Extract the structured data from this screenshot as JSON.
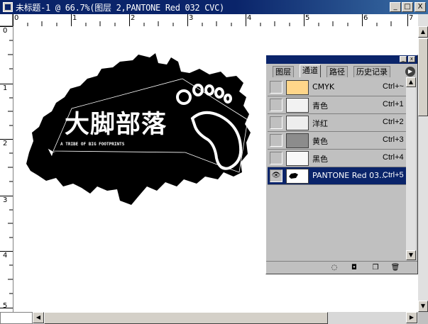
{
  "window": {
    "title": "未标题-1 @ 66.7%(图层 2,PANTONE Red 032 CVC)",
    "min_label": "_",
    "max_label": "□",
    "close_label": "X"
  },
  "ruler": {
    "top_ticks": [
      "0",
      "1",
      "2",
      "3",
      "4",
      "5",
      "6",
      "7"
    ],
    "left_ticks": [
      "0",
      "1",
      "2",
      "3",
      "4",
      "5"
    ]
  },
  "artwork": {
    "headline": "大脚部落",
    "tagline": "A TRIBE OF BIG FOOTPRINTS"
  },
  "palette": {
    "tabs": [
      "图层",
      "通道",
      "路径",
      "历史记录"
    ],
    "active_tab": "通道",
    "channels": [
      {
        "name": "CMYK",
        "shortcut": "Ctrl+~",
        "swatch": "#ffd68a",
        "visible": false,
        "selected": false
      },
      {
        "name": "青色",
        "shortcut": "Ctrl+1",
        "swatch": "#f2f2f2",
        "visible": false,
        "selected": false
      },
      {
        "name": "洋红",
        "shortcut": "Ctrl+2",
        "swatch": "#eeeeee",
        "visible": false,
        "selected": false
      },
      {
        "name": "黄色",
        "shortcut": "Ctrl+3",
        "swatch": "#8c8c8c",
        "visible": false,
        "selected": false
      },
      {
        "name": "黑色",
        "shortcut": "Ctrl+4",
        "swatch": "#f8f8f8",
        "visible": false,
        "selected": false
      },
      {
        "name": "PANTONE Red 03...",
        "shortcut": "Ctrl+5",
        "swatch": "#ffffff",
        "visible": true,
        "selected": true
      }
    ],
    "bottom_icons": [
      "load-selection-icon",
      "save-selection-icon",
      "new-channel-icon",
      "trash-icon"
    ]
  },
  "colors": {
    "titlebar": "#0a246a",
    "selection": "#0a246a",
    "artwork": "#000000"
  }
}
